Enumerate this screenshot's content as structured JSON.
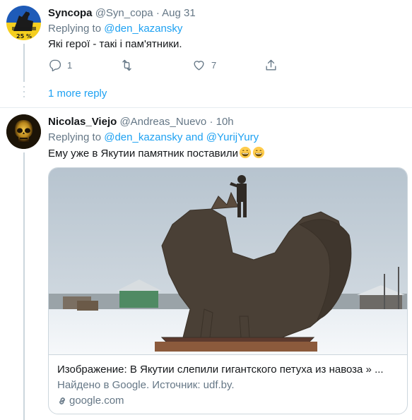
{
  "tweet1": {
    "display_name": "Syncopa",
    "handle": "@Syn_copa",
    "separator": "·",
    "time": "Aug 31",
    "replying_prefix": "Replying to ",
    "replying_to": "@den_kazansky",
    "text": "Які герої - такі і пам'ятники.",
    "avatar_badge": "25 %",
    "actions": {
      "reply_count": "1",
      "retweet_count": "",
      "like_count": "7"
    }
  },
  "more_reply": "1 more reply",
  "tweet2": {
    "display_name": "Nicolas_Viejo",
    "handle": "@Andreas_Nuevo",
    "separator": "·",
    "time": "10h",
    "replying_prefix": "Replying to ",
    "replying_to_1": "@den_kazansky",
    "replying_and": " and ",
    "replying_to_2": "@YurijYury",
    "text": "Ему уже в Якутии памятник поставили",
    "emoji": "grinning-face-emoji",
    "card": {
      "title": "Изображение: В Якутии слепили гигантского петуха из навоза » ...",
      "description": "Найдено в Google. Источник: udf.by.",
      "domain": "google.com"
    }
  },
  "colors": {
    "link": "#1da1f2",
    "secondary_text": "#657786",
    "border": "#ccd6dd",
    "divider": "#e6ecf0"
  }
}
